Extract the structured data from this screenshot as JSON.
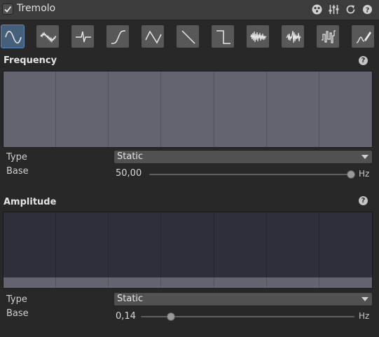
{
  "header": {
    "enabled": true,
    "title": "Tremolo",
    "icons": [
      "preset-icon",
      "settings-sliders-icon",
      "reset-icon",
      "help-icon"
    ]
  },
  "presets": [
    {
      "name": "sine-wave",
      "selected": true
    },
    {
      "name": "noise-sine-wave",
      "selected": false
    },
    {
      "name": "spike-wave",
      "selected": false
    },
    {
      "name": "s-curve-wave",
      "selected": false
    },
    {
      "name": "triangle-wave",
      "selected": false
    },
    {
      "name": "sawtooth-wave",
      "selected": false
    },
    {
      "name": "square-wave",
      "selected": false
    },
    {
      "name": "noise-wave",
      "selected": false
    },
    {
      "name": "burst-noise-wave",
      "selected": false
    },
    {
      "name": "step-noise-wave",
      "selected": false
    },
    {
      "name": "custom-curve-wave",
      "selected": false
    }
  ],
  "frequency": {
    "title": "Frequency",
    "help": "?",
    "type_label": "Type",
    "type_value": "Static",
    "base_label": "Base",
    "base_value": "50,00",
    "slider_fraction": 1.0,
    "unit": "Hz",
    "graph_level": 1.0
  },
  "amplitude": {
    "title": "Amplitude",
    "help": "?",
    "type_label": "Type",
    "type_value": "Static",
    "base_label": "Base",
    "base_value": "0,14",
    "slider_fraction": 0.14,
    "unit": "Hz",
    "graph_level": 0.14
  },
  "colors": {
    "graph_background": "#2e2f3b",
    "graph_fill": "#646470",
    "selected_preset": "#46607c"
  }
}
